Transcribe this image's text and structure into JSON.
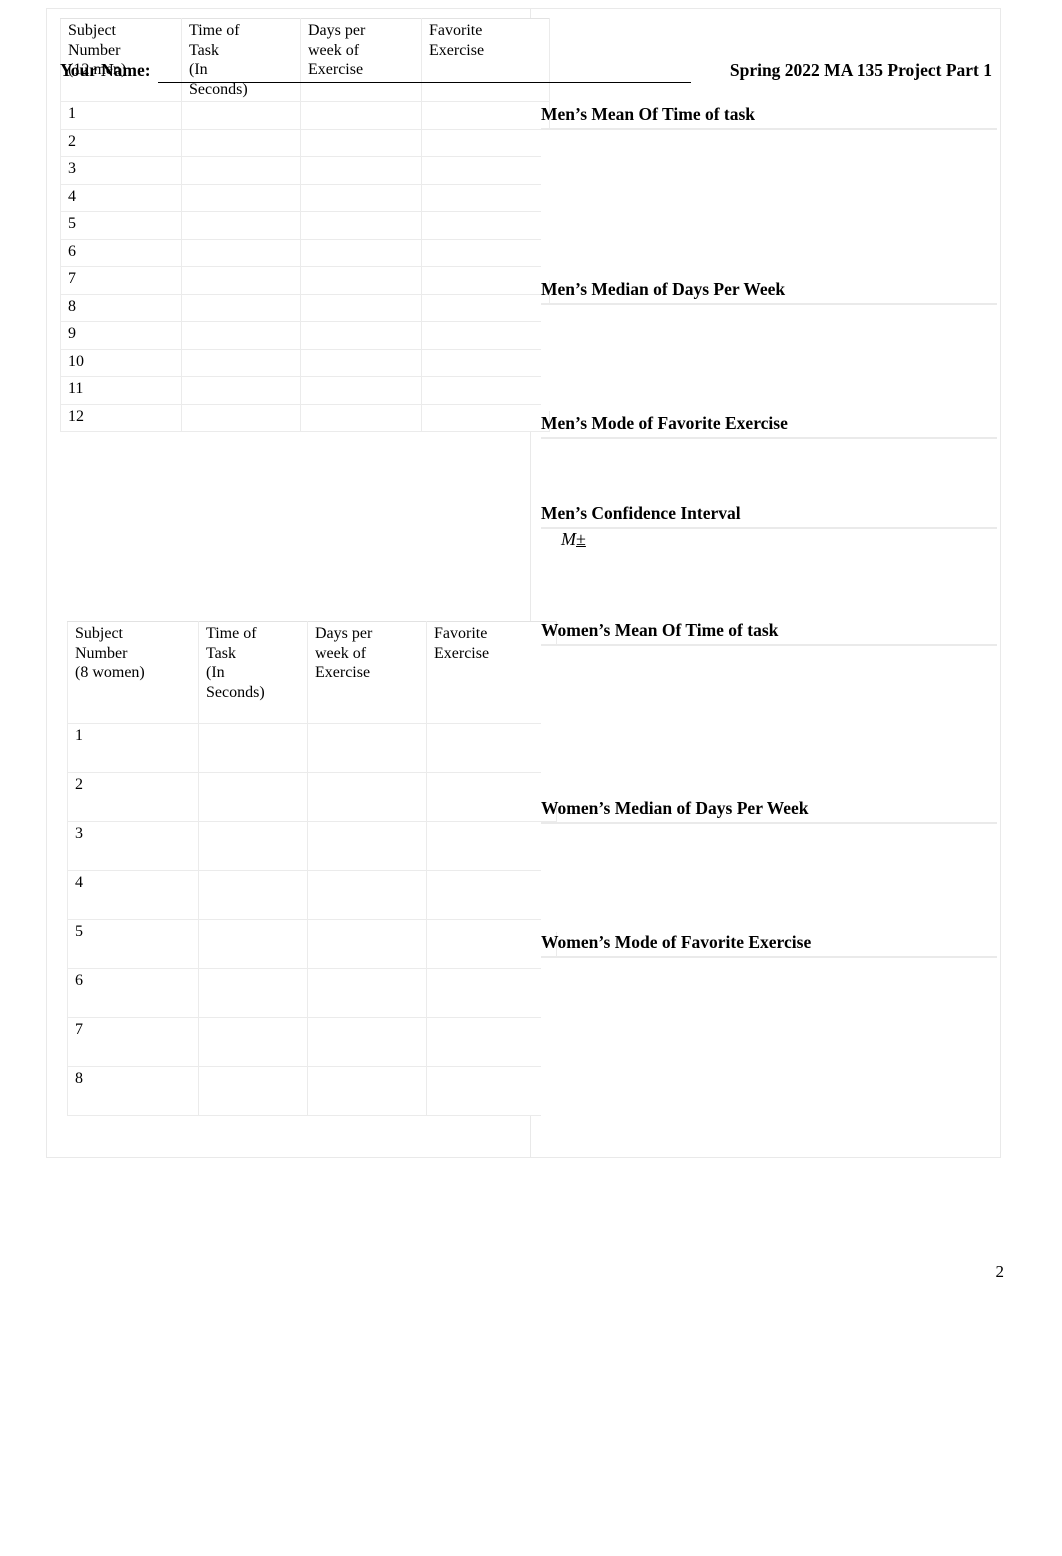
{
  "header": {
    "name_label": "Your Name:",
    "course_title": "Spring 2022 MA 135 Project Part 1"
  },
  "men_table": {
    "columns": [
      "Subject Number",
      "Time of Task (In Seconds)",
      "Days per week of Exercise",
      "Favorite Exercise"
    ],
    "column_lines": {
      "c0_line1": "Subject",
      "c0_line2": "Number",
      "c0_line3": "(12 men)",
      "c1_line1": "Time of",
      "c1_line2": "Task",
      "c1_line3": "(In",
      "c1_line4": "Seconds)",
      "c2_line1": "Days per",
      "c2_line2": "week of",
      "c2_line3": "Exercise",
      "c3_line1": "Favorite",
      "c3_line2": "Exercise"
    },
    "subject_count_label": "(12 men)",
    "rows": [
      {
        "subject": "1",
        "time": "",
        "days": "",
        "exercise": ""
      },
      {
        "subject": "2",
        "time": "",
        "days": "",
        "exercise": ""
      },
      {
        "subject": "3",
        "time": "",
        "days": "",
        "exercise": ""
      },
      {
        "subject": "4",
        "time": "",
        "days": "",
        "exercise": ""
      },
      {
        "subject": "5",
        "time": "",
        "days": "",
        "exercise": ""
      },
      {
        "subject": "6",
        "time": "",
        "days": "",
        "exercise": ""
      },
      {
        "subject": "7",
        "time": "",
        "days": "",
        "exercise": ""
      },
      {
        "subject": "8",
        "time": "",
        "days": "",
        "exercise": ""
      },
      {
        "subject": "9",
        "time": "",
        "days": "",
        "exercise": ""
      },
      {
        "subject": "10",
        "time": "",
        "days": "",
        "exercise": ""
      },
      {
        "subject": "11",
        "time": "",
        "days": "",
        "exercise": ""
      },
      {
        "subject": "12",
        "time": "",
        "days": "",
        "exercise": ""
      }
    ]
  },
  "women_table": {
    "column_lines": {
      "c0_line1": "Subject",
      "c0_line2": "Number",
      "c0_line3": "(8 women)",
      "c1_line1": "Time of",
      "c1_line2": "Task",
      "c1_line3": "(In",
      "c1_line4": "Seconds)",
      "c2_line1": "Days per",
      "c2_line2": "week of",
      "c2_line3": "Exercise",
      "c3_line1": "Favorite",
      "c3_line2": "Exercise"
    },
    "subject_count_label": "(8 women)",
    "rows": [
      {
        "subject": "1",
        "time": "",
        "days": "",
        "exercise": ""
      },
      {
        "subject": "2",
        "time": "",
        "days": "",
        "exercise": ""
      },
      {
        "subject": "3",
        "time": "",
        "days": "",
        "exercise": ""
      },
      {
        "subject": "4",
        "time": "",
        "days": "",
        "exercise": ""
      },
      {
        "subject": "5",
        "time": "",
        "days": "",
        "exercise": ""
      },
      {
        "subject": "6",
        "time": "",
        "days": "",
        "exercise": ""
      },
      {
        "subject": "7",
        "time": "",
        "days": "",
        "exercise": ""
      },
      {
        "subject": "8",
        "time": "",
        "days": "",
        "exercise": ""
      }
    ]
  },
  "answers": {
    "men_mean": {
      "heading": "Men’s Mean Of Time of task",
      "value": ""
    },
    "men_median": {
      "heading": "Men’s Median of Days Per Week",
      "value": ""
    },
    "men_mode": {
      "heading": "Men’s Mode of Favorite Exercise",
      "value": ""
    },
    "men_ci": {
      "heading": "Men’s Confidence Interval",
      "expr_symbol": "M",
      "expr_operator": "±",
      "value": ""
    },
    "women_mean": {
      "heading": "Women’s Mean Of Time of task",
      "value": ""
    },
    "women_median": {
      "heading": "Women’s Median of Days Per Week",
      "value": ""
    },
    "women_mode": {
      "heading": "Women’s Mode of Favorite Exercise",
      "value": ""
    }
  },
  "footer": {
    "page_number": "2"
  }
}
